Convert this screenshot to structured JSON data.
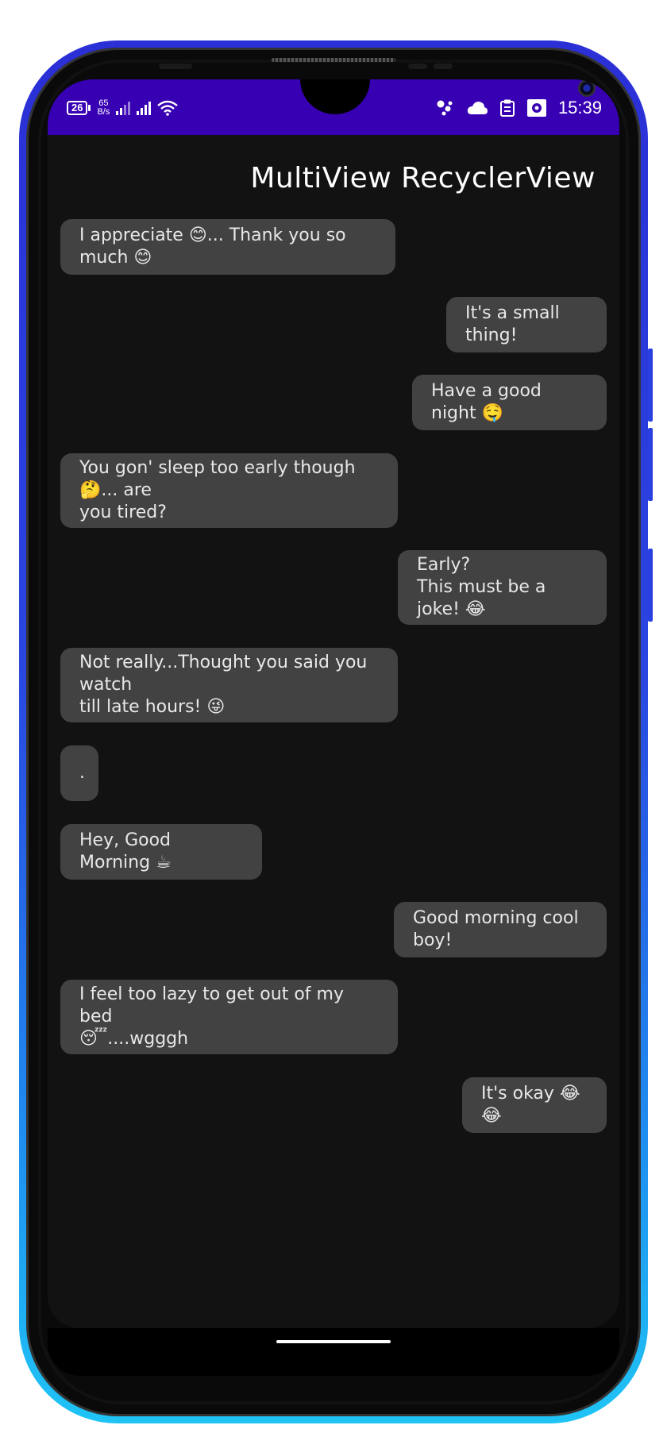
{
  "status_bar": {
    "battery_level": "26",
    "net_speed_value": "65",
    "net_speed_unit": "B/s",
    "time": "15:39",
    "icons": [
      "battery-icon",
      "signal-icon",
      "signal-icon",
      "wifi-icon",
      "assistant-icon",
      "cloud-icon",
      "clipboard-icon",
      "notification-app-icon"
    ],
    "background_color": "#3700b3"
  },
  "app_bar": {
    "title": "MultiView RecyclerView"
  },
  "messages": [
    {
      "side": "left",
      "text": "I appreciate 😊... Thank you so much 😊"
    },
    {
      "side": "right",
      "text": "It's a small thing!"
    },
    {
      "side": "right",
      "text": "Have a good night 🤤"
    },
    {
      "side": "left",
      "text": "You gon' sleep too early though🤔... are\nyou tired?"
    },
    {
      "side": "right",
      "text": "Early?\nThis must be a joke! 😂"
    },
    {
      "side": "left",
      "text": "Not really...Thought you said you watch\ntill late hours! 😜"
    },
    {
      "side": "left",
      "text": "."
    },
    {
      "side": "left",
      "text": "Hey, Good Morning ☕"
    },
    {
      "side": "right",
      "text": "Good morning cool boy!"
    },
    {
      "side": "left",
      "text": "I feel too lazy to get out of my bed\n😴....wgggh"
    },
    {
      "side": "right",
      "text": "It's okay 😂 😂"
    }
  ],
  "colors": {
    "screen_background": "#121212",
    "bubble_background": "#424242",
    "bubble_text": "#e8e8e8",
    "frame_gradient_top": "#2a2fd6",
    "frame_gradient_bottom": "#1fc4f5"
  }
}
